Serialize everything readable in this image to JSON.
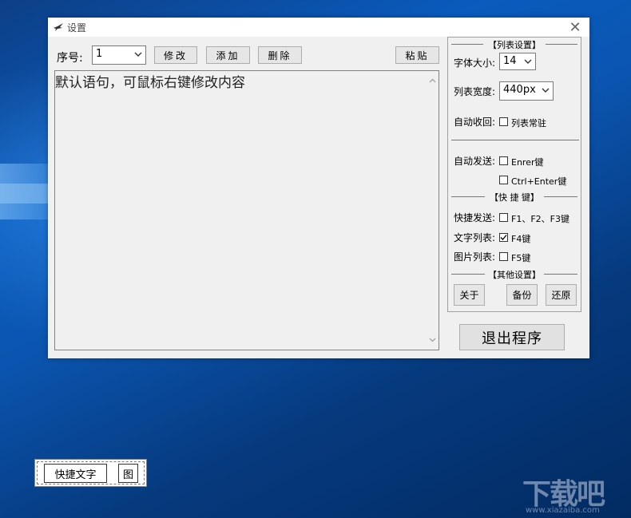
{
  "window": {
    "title": "设置",
    "close_glyph": "✕"
  },
  "toolbar": {
    "seq_label": "序号:",
    "seq_value": "1",
    "modify_label": "修改",
    "add_label": "添加",
    "delete_label": "删除",
    "paste_label": "粘贴"
  },
  "editor": {
    "text": "默认语句，可鼠标右键修改内容"
  },
  "list_settings": {
    "header": "【列表设置】",
    "font_size_label": "字体大小:",
    "font_size_value": "14",
    "list_width_label": "列表宽度:",
    "list_width_value": "440px",
    "auto_collapse_label": "自动收回:",
    "list_resident_label": "列表常驻",
    "list_resident_checked": false,
    "auto_send_label": "自动发送:",
    "enter_key_label": "Enrer键",
    "enter_key_checked": false,
    "ctrl_enter_label": "Ctrl+Enter键",
    "ctrl_enter_checked": false
  },
  "hotkeys": {
    "header": "【快 捷 键】",
    "quick_send_label": "快捷发送:",
    "quick_send_keys": "F1、F2、F3键",
    "quick_send_checked": false,
    "text_list_label": "文字列表:",
    "text_list_key": "F4键",
    "text_list_checked": true,
    "image_list_label": "图片列表:",
    "image_list_key": "F5键",
    "image_list_checked": false
  },
  "other_settings": {
    "header": "【其他设置】",
    "about_label": "关于",
    "backup_label": "备份",
    "restore_label": "还原"
  },
  "exit_label": "退出程序",
  "minibar": {
    "quick_text_label": "快捷文字",
    "image_label": "图"
  },
  "watermark": {
    "brand": "下载吧",
    "url": "www.xiazaiba.com"
  },
  "colors": {
    "desktop_blue": "#0a5bbd",
    "window_bg": "#f0f0f0",
    "titlebar_bg": "#ffffff"
  }
}
